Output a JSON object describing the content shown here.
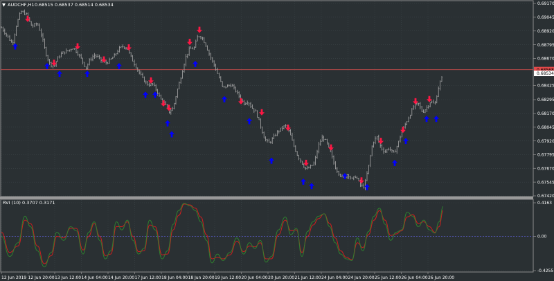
{
  "window": {
    "symbol_title": "AUDCHF,H1",
    "ohlc_readout": "0.68515 0.68537 0.68514 0.68534",
    "indicator_title": "RVI (10) 0.3707 0.3171"
  },
  "colors": {
    "background": "#2a3033",
    "grid": "#3c4548",
    "axis_text": "#ffffff",
    "candles": "#a9a9a9",
    "up_arrow": "#0000ff",
    "down_arrow": "#ff1744",
    "hline": "#b94a4a",
    "rvi_main": "#2f7d2f",
    "rvi_signal": "#cc1f1f",
    "zero_line": "#5a5ad0",
    "ask_tag": "#e34a4a",
    "bid_tag": "#ffffff"
  },
  "chart_data": [
    {
      "type": "candlestick",
      "title": "AUDCHF,H1",
      "y_ticks": [
        "0.69170",
        "0.69045",
        "0.68920",
        "0.68795",
        "0.68670",
        "0.68425",
        "0.68295",
        "0.68170",
        "0.68045",
        "0.67920",
        "0.67795",
        "0.67670",
        "0.67545",
        "0.67420"
      ],
      "price_tags": {
        "ask": "0.68568",
        "bid": "0.68534"
      },
      "ylim": [
        0.6742,
        0.6917
      ],
      "horizontal_line": 0.68568,
      "x_ticks": [
        "12 Jun 2019",
        "12 Jun 20:00",
        "13 Jun 12:00",
        "14 Jun 04:00",
        "14 Jun 20:00",
        "17 Jun 12:00",
        "18 Jun 04:00",
        "18 Jun 20:00",
        "19 Jun 12:00",
        "20 Jun 04:00",
        "20 Jun 20:00",
        "21 Jun 12:00",
        "24 Jun 04:00",
        "24 Jun 20:00",
        "25 Jun 12:00",
        "26 Jun 04:00",
        "26 Jun 20:00"
      ],
      "price_path": [
        [
          0,
          0.6895
        ],
        [
          8,
          0.6888
        ],
        [
          16,
          0.688
        ],
        [
          22,
          0.6898
        ],
        [
          28,
          0.691
        ],
        [
          36,
          0.6907
        ],
        [
          44,
          0.6896
        ],
        [
          52,
          0.6899
        ],
        [
          58,
          0.6888
        ],
        [
          64,
          0.6872
        ],
        [
          70,
          0.6862
        ],
        [
          76,
          0.686
        ],
        [
          82,
          0.6868
        ],
        [
          88,
          0.6872
        ],
        [
          96,
          0.6874
        ],
        [
          104,
          0.6877
        ],
        [
          110,
          0.6872
        ],
        [
          116,
          0.6866
        ],
        [
          122,
          0.6858
        ],
        [
          128,
          0.6866
        ],
        [
          134,
          0.687
        ],
        [
          140,
          0.6868
        ],
        [
          146,
          0.6864
        ],
        [
          152,
          0.6863
        ],
        [
          158,
          0.6866
        ],
        [
          164,
          0.687
        ],
        [
          170,
          0.6876
        ],
        [
          176,
          0.6878
        ],
        [
          182,
          0.6876
        ],
        [
          188,
          0.6867
        ],
        [
          194,
          0.686
        ],
        [
          200,
          0.6853
        ],
        [
          206,
          0.6847
        ],
        [
          212,
          0.6843
        ],
        [
          218,
          0.6844
        ],
        [
          224,
          0.6838
        ],
        [
          230,
          0.683
        ],
        [
          236,
          0.6826
        ],
        [
          242,
          0.6818
        ],
        [
          248,
          0.6822
        ],
        [
          254,
          0.6838
        ],
        [
          260,
          0.6852
        ],
        [
          266,
          0.6868
        ],
        [
          272,
          0.6876
        ],
        [
          278,
          0.6876
        ],
        [
          284,
          0.6888
        ],
        [
          290,
          0.6886
        ],
        [
          296,
          0.6878
        ],
        [
          302,
          0.6868
        ],
        [
          308,
          0.686
        ],
        [
          314,
          0.685
        ],
        [
          320,
          0.684
        ],
        [
          326,
          0.6842
        ],
        [
          332,
          0.6843
        ],
        [
          338,
          0.6838
        ],
        [
          344,
          0.6832
        ],
        [
          350,
          0.6826
        ],
        [
          356,
          0.6828
        ],
        [
          362,
          0.6822
        ],
        [
          368,
          0.6818
        ],
        [
          374,
          0.6806
        ],
        [
          380,
          0.6794
        ],
        [
          386,
          0.679
        ],
        [
          392,
          0.6794
        ],
        [
          398,
          0.68
        ],
        [
          404,
          0.6803
        ],
        [
          410,
          0.6806
        ],
        [
          416,
          0.68
        ],
        [
          422,
          0.6788
        ],
        [
          428,
          0.6778
        ],
        [
          434,
          0.6772
        ],
        [
          440,
          0.6766
        ],
        [
          446,
          0.6768
        ],
        [
          452,
          0.6772
        ],
        [
          458,
          0.6788
        ],
        [
          464,
          0.6796
        ],
        [
          470,
          0.679
        ],
        [
          476,
          0.678
        ],
        [
          482,
          0.6768
        ],
        [
          488,
          0.6762
        ],
        [
          494,
          0.6758
        ],
        [
          500,
          0.6762
        ],
        [
          506,
          0.6757
        ],
        [
          512,
          0.676
        ],
        [
          518,
          0.6752
        ],
        [
          524,
          0.675
        ],
        [
          530,
          0.6768
        ],
        [
          536,
          0.679
        ],
        [
          542,
          0.6796
        ],
        [
          548,
          0.6786
        ],
        [
          554,
          0.6782
        ],
        [
          560,
          0.6786
        ],
        [
          566,
          0.678
        ],
        [
          572,
          0.6788
        ],
        [
          578,
          0.68
        ],
        [
          584,
          0.6808
        ],
        [
          590,
          0.6816
        ],
        [
          596,
          0.6824
        ],
        [
          602,
          0.6826
        ],
        [
          608,
          0.6818
        ],
        [
          614,
          0.6822
        ],
        [
          620,
          0.6828
        ],
        [
          626,
          0.6825
        ],
        [
          632,
          0.6843
        ],
        [
          638,
          0.6852
        ]
      ],
      "down_arrows": [
        [
          38,
          0.6903
        ],
        [
          76,
          0.6863
        ],
        [
          110,
          0.6878
        ],
        [
          148,
          0.6866
        ],
        [
          184,
          0.6877
        ],
        [
          216,
          0.6847
        ],
        [
          234,
          0.6826
        ],
        [
          242,
          0.6822
        ],
        [
          272,
          0.6882
        ],
        [
          286,
          0.6893
        ],
        [
          346,
          0.6828
        ],
        [
          376,
          0.6818
        ],
        [
          414,
          0.6804
        ],
        [
          440,
          0.6772
        ],
        [
          476,
          0.6786
        ],
        [
          520,
          0.6756
        ],
        [
          548,
          0.6792
        ],
        [
          580,
          0.6802
        ],
        [
          598,
          0.6828
        ],
        [
          618,
          0.683
        ]
      ],
      "up_arrows": [
        [
          20,
          0.6878
        ],
        [
          66,
          0.686
        ],
        [
          84,
          0.6853
        ],
        [
          124,
          0.6853
        ],
        [
          170,
          0.686
        ],
        [
          208,
          0.6834
        ],
        [
          222,
          0.6834
        ],
        [
          240,
          0.6808
        ],
        [
          246,
          0.6798
        ],
        [
          280,
          0.6862
        ],
        [
          322,
          0.683
        ],
        [
          358,
          0.681
        ],
        [
          390,
          0.6774
        ],
        [
          436,
          0.6755
        ],
        [
          448,
          0.6751
        ],
        [
          496,
          0.676
        ],
        [
          528,
          0.675
        ],
        [
          568,
          0.6772
        ],
        [
          584,
          0.6792
        ],
        [
          614,
          0.6812
        ],
        [
          628,
          0.6812
        ]
      ]
    },
    {
      "type": "line",
      "title": "RVI (10) 0.3707 0.3171",
      "y_ticks": [
        "0.4163",
        "0.00",
        "-0.4255"
      ],
      "ylim": [
        -0.4255,
        0.4163
      ],
      "zero_line": 0,
      "series": [
        {
          "name": "RVI",
          "x": [
            0,
            12,
            24,
            34,
            42,
            52,
            62,
            72,
            80,
            90,
            100,
            108,
            118,
            126,
            134,
            142,
            150,
            158,
            166,
            174,
            182,
            190,
            198,
            206,
            214,
            222,
            232,
            240,
            248,
            256,
            264,
            272,
            280,
            288,
            296,
            304,
            312,
            320,
            330,
            340,
            350,
            358,
            366,
            374,
            382,
            390,
            400,
            410,
            418,
            426,
            434,
            442,
            450,
            458,
            466,
            474,
            482,
            490,
            498,
            506,
            514,
            522,
            530,
            538,
            546,
            554,
            562,
            570,
            578,
            586,
            594,
            602,
            610,
            618,
            626,
            632,
            638
          ],
          "values": [
            0.0,
            -0.25,
            -0.08,
            0.25,
            0.12,
            -0.18,
            -0.38,
            -0.2,
            0.05,
            -0.05,
            0.12,
            0.07,
            -0.22,
            0.05,
            0.18,
            -0.05,
            -0.28,
            -0.18,
            0.18,
            0.08,
            0.2,
            -0.05,
            -0.22,
            -0.15,
            0.2,
            0.08,
            -0.28,
            -0.18,
            0.15,
            0.32,
            0.41,
            0.38,
            0.32,
            0.18,
            -0.05,
            -0.33,
            -0.22,
            -0.3,
            -0.2,
            -0.02,
            -0.22,
            -0.08,
            -0.15,
            -0.05,
            -0.32,
            -0.25,
            0.08,
            0.24,
            0.02,
            0.1,
            -0.25,
            0.06,
            0.18,
            0.25,
            0.28,
            0.12,
            -0.08,
            -0.22,
            -0.28,
            -0.3,
            -0.02,
            -0.18,
            0.06,
            0.25,
            0.35,
            0.15,
            -0.05,
            0.05,
            0.08,
            0.3,
            0.25,
            0.12,
            0.2,
            0.08,
            0.04,
            0.18,
            0.37
          ]
        },
        {
          "name": "Signal",
          "x": [
            0,
            12,
            24,
            34,
            42,
            52,
            62,
            72,
            80,
            90,
            100,
            108,
            118,
            126,
            134,
            142,
            150,
            158,
            166,
            174,
            182,
            190,
            198,
            206,
            214,
            222,
            232,
            240,
            248,
            256,
            264,
            272,
            280,
            288,
            296,
            304,
            312,
            320,
            330,
            340,
            350,
            358,
            366,
            374,
            382,
            390,
            400,
            410,
            418,
            426,
            434,
            442,
            450,
            458,
            466,
            474,
            482,
            490,
            498,
            506,
            514,
            522,
            530,
            538,
            546,
            554,
            562,
            570,
            578,
            586,
            594,
            602,
            610,
            618,
            626,
            632,
            638
          ],
          "values": [
            0.05,
            -0.2,
            -0.12,
            0.2,
            0.16,
            -0.12,
            -0.34,
            -0.24,
            0.0,
            -0.02,
            0.1,
            0.1,
            -0.17,
            0.0,
            0.16,
            0.0,
            -0.24,
            -0.22,
            0.12,
            0.12,
            0.18,
            0.0,
            -0.19,
            -0.18,
            0.14,
            0.12,
            -0.23,
            -0.22,
            0.08,
            0.26,
            0.4,
            0.39,
            0.35,
            0.24,
            0.02,
            -0.28,
            -0.26,
            -0.28,
            -0.23,
            -0.06,
            -0.19,
            -0.12,
            -0.13,
            -0.08,
            -0.28,
            -0.28,
            0.02,
            0.2,
            0.07,
            0.08,
            -0.2,
            0.0,
            0.14,
            0.22,
            0.28,
            0.16,
            -0.02,
            -0.18,
            -0.26,
            -0.29,
            -0.08,
            -0.14,
            0.02,
            0.2,
            0.32,
            0.2,
            0.01,
            0.03,
            0.07,
            0.24,
            0.27,
            0.16,
            0.18,
            0.12,
            0.05,
            0.12,
            0.32
          ]
        }
      ]
    }
  ]
}
